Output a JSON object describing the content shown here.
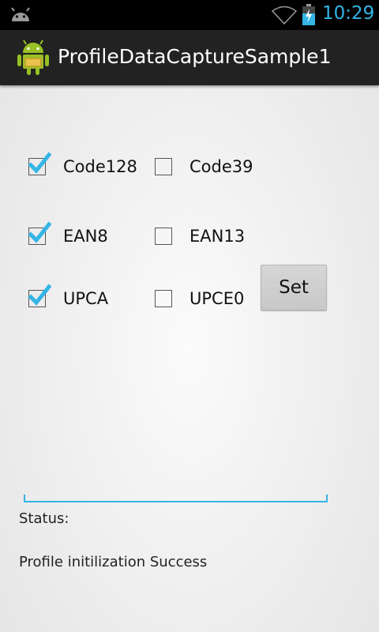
{
  "status_bar": {
    "time": "10:29",
    "icons": [
      "android-notification-icon",
      "wifi-icon",
      "battery-charging-icon"
    ],
    "accent_color": "#33b5e5"
  },
  "action_bar": {
    "title": "ProfileDataCaptureSample1",
    "icon": "android-app-icon"
  },
  "checkboxes": [
    {
      "label": "Code128",
      "checked": true
    },
    {
      "label": "Code39",
      "checked": false
    },
    {
      "label": "EAN8",
      "checked": true
    },
    {
      "label": "EAN13",
      "checked": false
    },
    {
      "label": "UPCA",
      "checked": true
    },
    {
      "label": "UPCE0",
      "checked": false
    }
  ],
  "set_button": {
    "label": "Set"
  },
  "input": {
    "value": ""
  },
  "status": {
    "label": "Status:",
    "message": "Profile initilization Success"
  },
  "colors": {
    "check_mark": "#33b5e5",
    "action_bar": "#222222"
  }
}
